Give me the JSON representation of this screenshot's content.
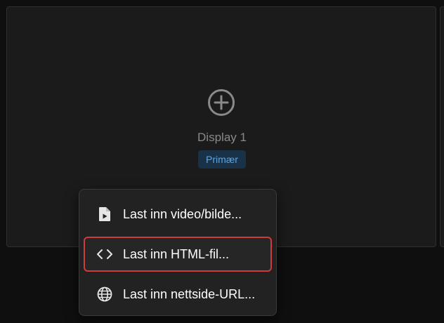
{
  "display": {
    "name": "Display 1",
    "badge": "Primær",
    "add_icon": "plus-circle-icon"
  },
  "menu": {
    "items": [
      {
        "label": "Last inn video/bilde...",
        "icon": "file-video-icon",
        "highlighted": false
      },
      {
        "label": "Last inn HTML-fil...",
        "icon": "code-icon",
        "highlighted": true
      },
      {
        "label": "Last inn nettside-URL...",
        "icon": "globe-icon",
        "highlighted": false
      }
    ]
  },
  "colors": {
    "background": "#0f0f0f",
    "card": "#1b1b1b",
    "menu": "#222222",
    "badge_bg": "#1a3247",
    "badge_text": "#5aa6e6",
    "highlight_border": "#d33a3a"
  }
}
